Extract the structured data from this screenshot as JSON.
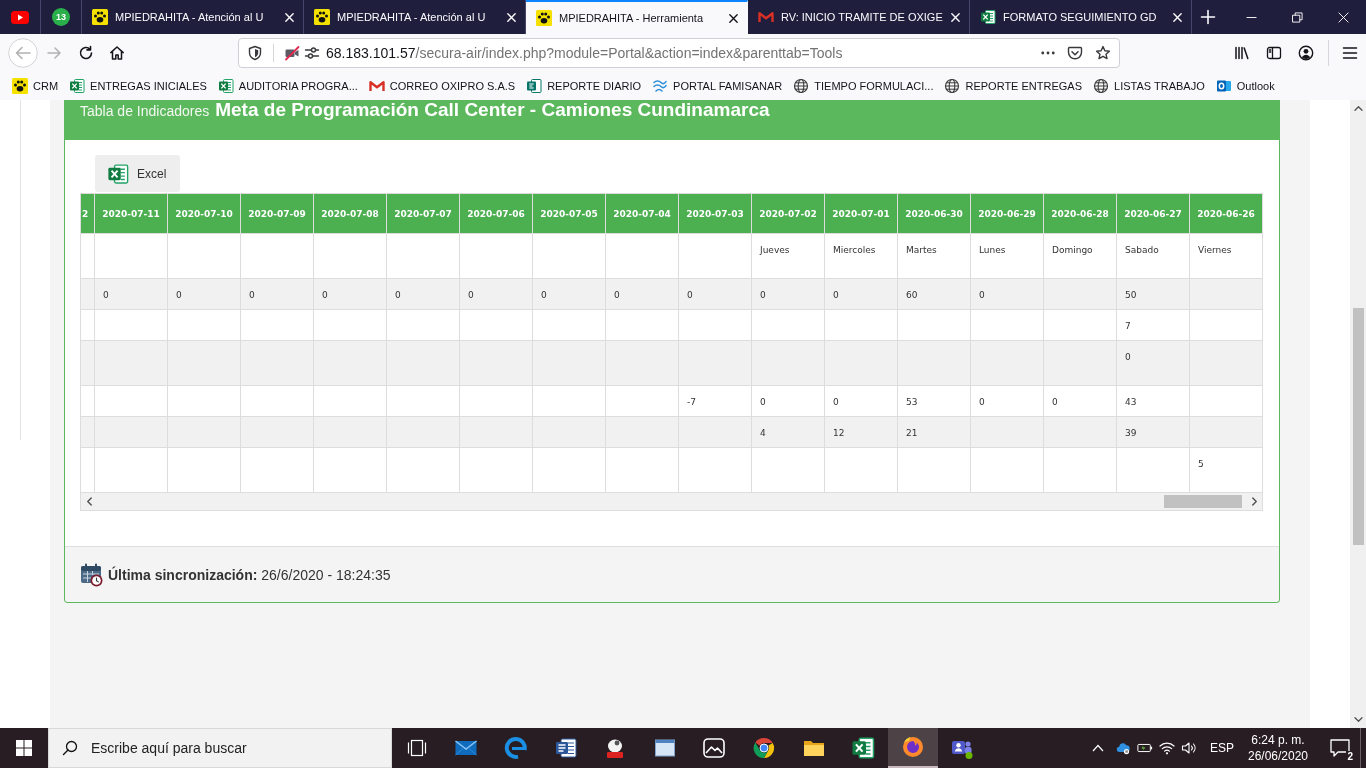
{
  "browser": {
    "tabs": [
      {
        "kind": "pinned",
        "selected": false
      },
      {
        "kind": "pinned",
        "badge": "13",
        "selected": false
      },
      {
        "kind": "tab",
        "title": "MPIEDRAHITA - Atención al U",
        "selected": false
      },
      {
        "kind": "tab",
        "title": "MPIEDRAHITA - Atención al U",
        "selected": false
      },
      {
        "kind": "tab",
        "title": "MPIEDRAHITA - Herramienta",
        "selected": true
      },
      {
        "kind": "tab",
        "title": "RV: INICIO TRAMITE DE OXIGE",
        "selected": false
      },
      {
        "kind": "tab",
        "title": "FORMATO SEGUIMIENTO GD",
        "selected": false
      }
    ],
    "navigation": {
      "back": {
        "disabled": true
      },
      "forward": {
        "disabled": true
      }
    },
    "address": {
      "host": "68.183.101.57",
      "path": "/secura-air/index.php?module=Portal&action=index&parenttab=Tools"
    },
    "bookmarks": [
      "CRM",
      "ENTREGAS INICIALES",
      "AUDITORIA PROGRA...",
      "CORREO OXIPRO S.A.S",
      "REPORTE DIARIO",
      "PORTAL FAMISANAR",
      "TIEMPO FORMULACI...",
      "REPORTE ENTREGAS",
      "LISTAS TRABAJO",
      "Outlook"
    ]
  },
  "panel": {
    "subtitle": "Tabla de Indicadores",
    "title": "Meta de Programación Call Center - Camiones Cundinamarca",
    "export_button": "Excel",
    "table": {
      "columns": [
        "2",
        "2020-07-11",
        "2020-07-10",
        "2020-07-09",
        "2020-07-08",
        "2020-07-07",
        "2020-07-06",
        "2020-07-05",
        "2020-07-04",
        "2020-07-03",
        "2020-07-02",
        "2020-07-01",
        "2020-06-30",
        "2020-06-29",
        "2020-06-28",
        "2020-06-27",
        "2020-06-26"
      ],
      "rows": [
        [
          null,
          null,
          null,
          null,
          null,
          null,
          null,
          null,
          null,
          null,
          "Jueves",
          "Miercoles",
          "Martes",
          "Lunes",
          "Domingo",
          "Sabado",
          "Viernes"
        ],
        [
          null,
          "0",
          "0",
          "0",
          "0",
          "0",
          "0",
          "0",
          "0",
          "0",
          "0",
          "0",
          "60",
          "0",
          null,
          "50",
          null
        ],
        [
          null,
          null,
          null,
          null,
          null,
          null,
          null,
          null,
          null,
          null,
          null,
          null,
          null,
          null,
          null,
          "7",
          null
        ],
        [
          null,
          null,
          null,
          null,
          null,
          null,
          null,
          null,
          null,
          null,
          null,
          null,
          null,
          null,
          null,
          "0",
          null
        ],
        [
          null,
          null,
          null,
          null,
          null,
          null,
          null,
          null,
          null,
          "-7",
          "0",
          "0",
          "53",
          "0",
          "0",
          "43",
          null
        ],
        [
          null,
          null,
          null,
          null,
          null,
          null,
          null,
          null,
          null,
          null,
          "4",
          "12",
          "21",
          null,
          null,
          "39",
          null
        ],
        [
          null,
          null,
          null,
          null,
          null,
          null,
          null,
          null,
          null,
          null,
          null,
          null,
          null,
          null,
          null,
          null,
          "5"
        ]
      ]
    },
    "sync": "**Última sincronización:** 26/6/2020 - 18:24:35"
  },
  "taskbar": {
    "search": {
      "placeholder": "Escribe aquí para buscar"
    },
    "apps": [
      {
        "selected": false
      },
      {
        "selected": false
      },
      {
        "selected": false
      },
      {
        "selected": false
      },
      {
        "selected": false
      },
      {
        "selected": false
      },
      {
        "selected": false
      },
      {
        "selected": false
      },
      {
        "selected": false
      },
      {
        "selected": false
      },
      {
        "selected": true
      },
      {
        "selected": false
      }
    ],
    "language": "ESP",
    "time": "6:24 p. m.",
    "date": "26/06/2020",
    "notifications": "2"
  }
}
